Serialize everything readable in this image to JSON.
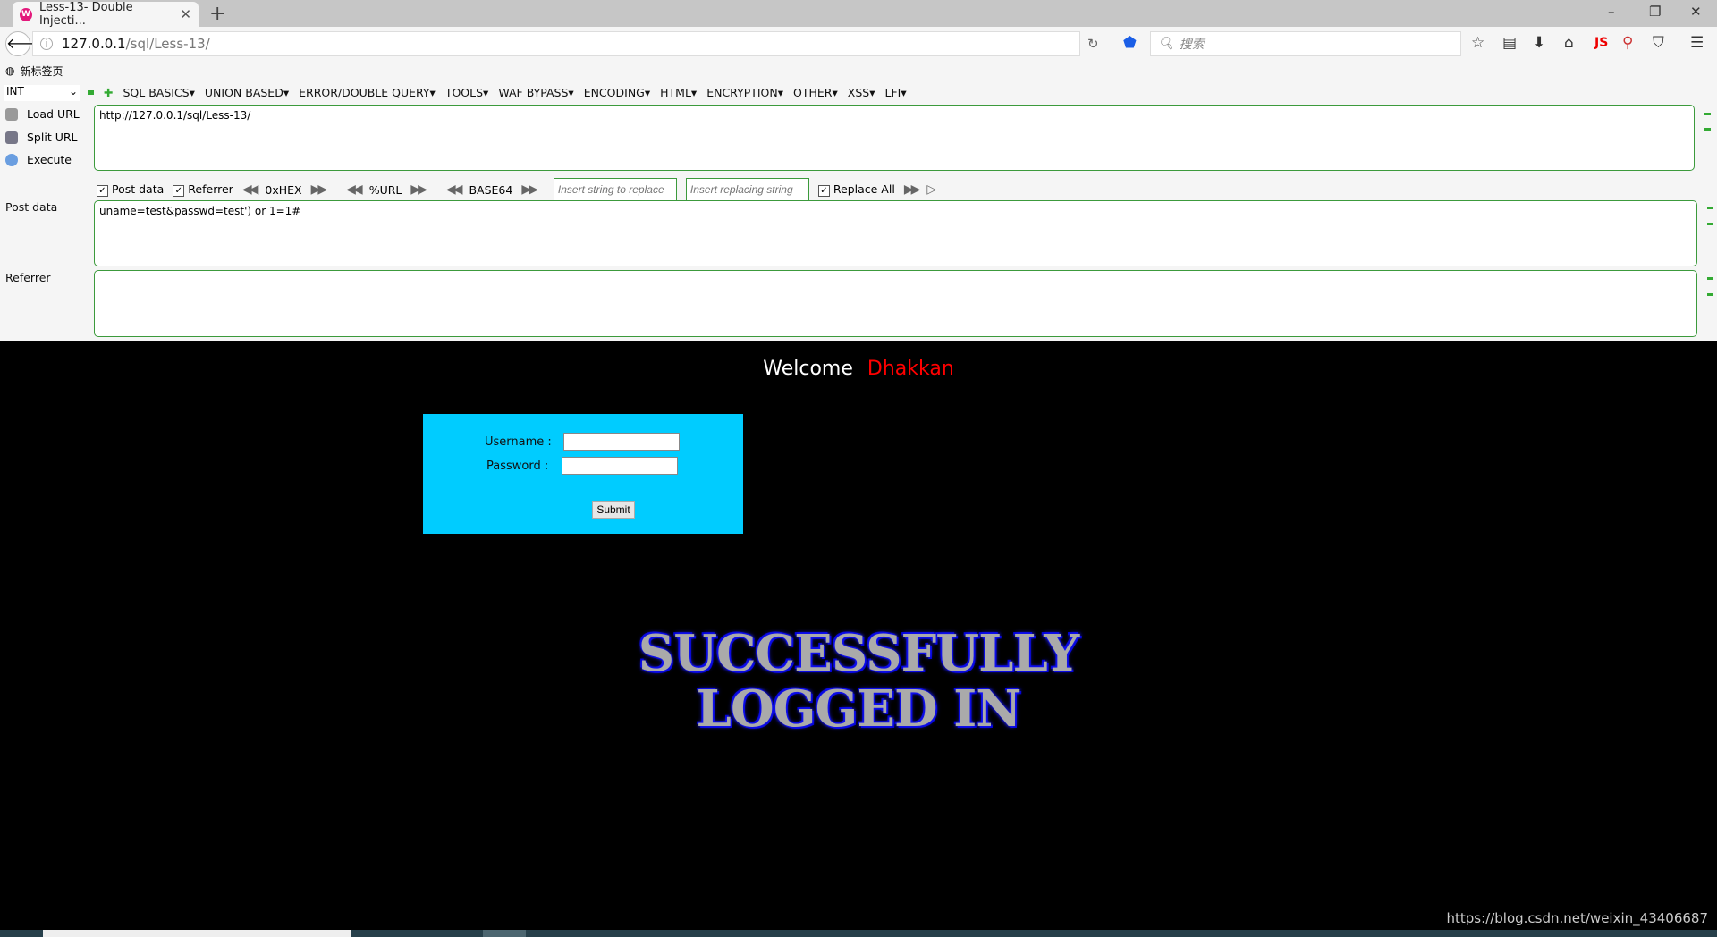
{
  "browser": {
    "tab_title": "Less-13- Double Injecti...",
    "url_host": "127.0.0.1",
    "url_path": "/sql/Less-13/",
    "search_placeholder": "搜索",
    "bookmark": "新标签页",
    "js_label": "JS"
  },
  "hackbar": {
    "type_select": "INT",
    "menu": [
      "SQL BASICS▾",
      "UNION BASED▾",
      "ERROR/DOUBLE QUERY▾",
      "TOOLS▾",
      "WAF BYPASS▾",
      "ENCODING▾",
      "HTML▾",
      "ENCRYPTION▾",
      "OTHER▾",
      "XSS▾",
      "LFI▾"
    ],
    "load_url": "Load URL",
    "split_url": "Split URL",
    "execute": "Execute",
    "url_value": "http://127.0.0.1/sql/Less-13/",
    "post_data_check": "Post data",
    "referrer_check": "Referrer",
    "hex": "0xHEX",
    "urlenc": "%URL",
    "base64": "BASE64",
    "replace_placeholder": "Insert string to replace",
    "replacing_placeholder": "Insert replacing string",
    "replace_all": "Replace All",
    "post_label": "Post data",
    "post_value": "uname=test&passwd=test') or 1=1#",
    "referrer_label": "Referrer",
    "referrer_value": ""
  },
  "page": {
    "welcome": "Welcome",
    "name": "Dhakkan",
    "username_label": "Username :",
    "password_label": "Password :",
    "submit": "Submit",
    "success_line1": "SUCCESSFULLY",
    "success_line2": "LOGGED IN",
    "login_bg": "#00ccff"
  },
  "watermark": "https://blog.csdn.net/weixin_43406687"
}
